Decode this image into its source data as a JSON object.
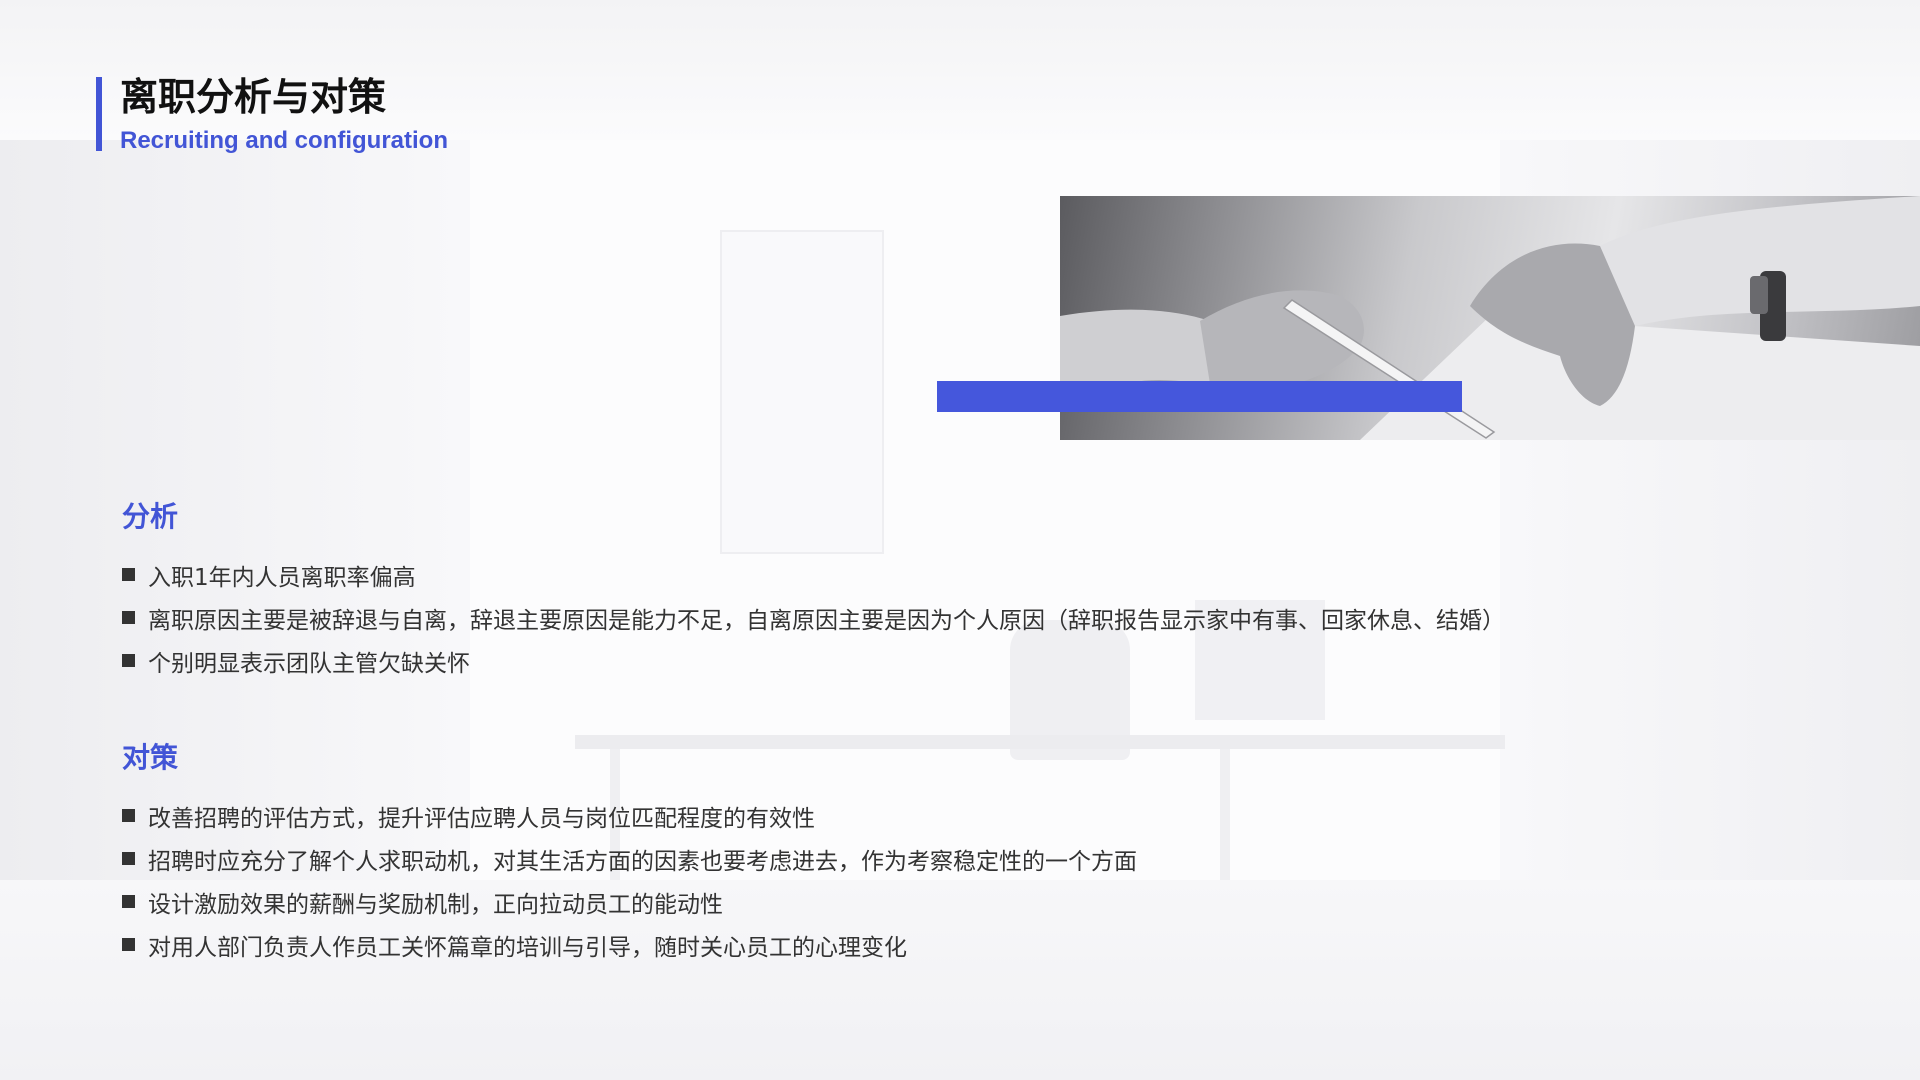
{
  "header": {
    "title": "离职分析与对策",
    "subtitle": "Recruiting and configuration"
  },
  "photo": {
    "icon": "hands-pen-document-photo"
  },
  "colors": {
    "accent": "#4255d6",
    "text": "#333333",
    "title": "#111111"
  },
  "analysis": {
    "title": "分析",
    "items": [
      "入职1年内人员离职率偏高",
      "离职原因主要是被辞退与自离，辞退主要原因是能力不足，自离原因主要是因为个人原因（辞职报告显示家中有事、回家休息、结婚）",
      "个别明显表示团队主管欠缺关怀"
    ]
  },
  "measures": {
    "title": "对策",
    "items": [
      "改善招聘的评估方式，提升评估应聘人员与岗位匹配程度的有效性",
      "招聘时应充分了解个人求职动机，对其生活方面的因素也要考虑进去，作为考察稳定性的一个方面",
      "设计激励效果的薪酬与奖励机制，正向拉动员工的能动性",
      "对用人部门负责人作员工关怀篇章的培训与引导，随时关心员工的心理变化"
    ]
  }
}
